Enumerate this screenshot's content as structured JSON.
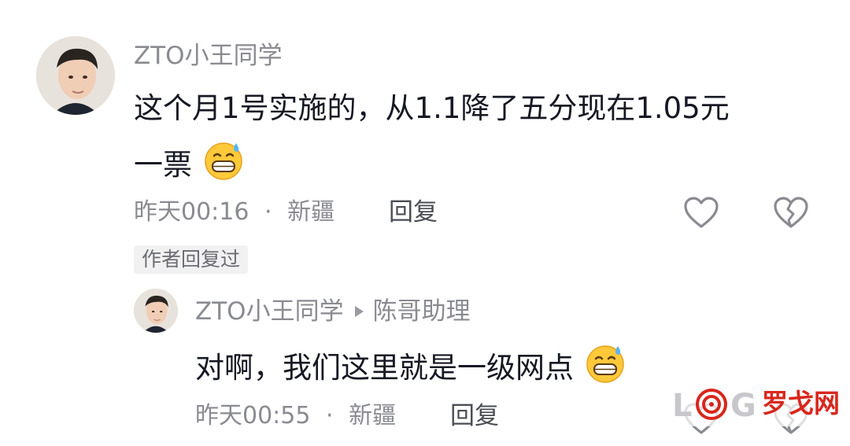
{
  "comment": {
    "username": "ZTO小王同学",
    "text_line1": "这个月1号实施的，从1.1降了五分现在1.05元",
    "text_line2": "一票",
    "emoji": "grinning-sweat-emoji",
    "time": "昨天00:16",
    "separator": "·",
    "location": "新疆",
    "reply_label": "回复",
    "author_replied_badge": "作者回复过"
  },
  "reply": {
    "username": "ZTO小王同学",
    "reply_to": "陈哥助理",
    "text": "对啊，我们这里就是一级网点",
    "emoji": "grinning-sweat-emoji",
    "time": "昨天00:55",
    "separator": "·",
    "location": "新疆",
    "reply_label": "回复"
  },
  "watermark": {
    "logo_letters": "LOG",
    "text": "罗戈网",
    "color": "#d9261c"
  },
  "colors": {
    "primary_text": "#161823",
    "secondary_text": "#8a8b91",
    "badge_bg": "#f1f1f2"
  }
}
